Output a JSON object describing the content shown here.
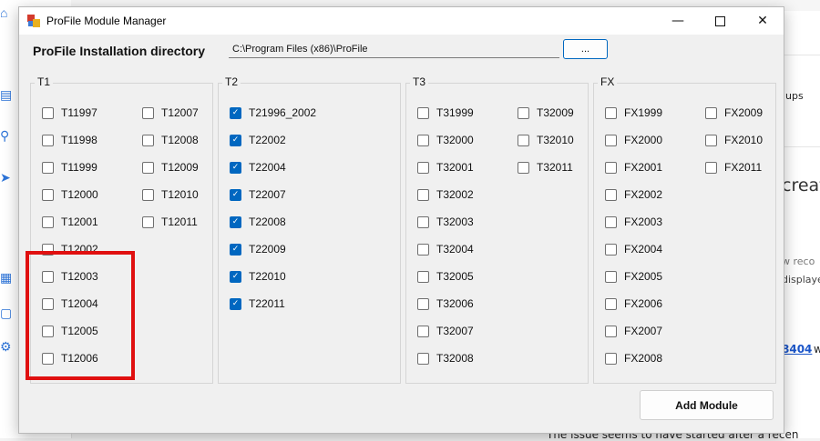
{
  "background": {
    "snippets": [
      "ups",
      "creat",
      "w reco",
      "displaye",
      "8404",
      "w"
    ],
    "bottom_text": "The issue seems to have started after a recen"
  },
  "window": {
    "title": "ProFile Module Manager",
    "minimize_glyph": "—",
    "close_glyph": "✕"
  },
  "install": {
    "label": "ProFile Installation directory",
    "path": "C:\\Program Files (x86)\\ProFile",
    "browse_label": "..."
  },
  "groups": [
    {
      "title": "T1",
      "columns": [
        [
          {
            "label": "T11997",
            "checked": false
          },
          {
            "label": "T11998",
            "checked": false
          },
          {
            "label": "T11999",
            "checked": false
          },
          {
            "label": "T12000",
            "checked": false
          },
          {
            "label": "T12001",
            "checked": false
          },
          {
            "label": "T12002",
            "checked": false
          },
          {
            "label": "T12003",
            "checked": false
          },
          {
            "label": "T12004",
            "checked": false
          },
          {
            "label": "T12005",
            "checked": false
          },
          {
            "label": "T12006",
            "checked": false
          }
        ],
        [
          {
            "label": "T12007",
            "checked": false
          },
          {
            "label": "T12008",
            "checked": false
          },
          {
            "label": "T12009",
            "checked": false
          },
          {
            "label": "T12010",
            "checked": false
          },
          {
            "label": "T12011",
            "checked": false
          }
        ]
      ]
    },
    {
      "title": "T2",
      "columns": [
        [
          {
            "label": "T21996_2002",
            "checked": true
          },
          {
            "label": "T22002",
            "checked": true
          },
          {
            "label": "T22004",
            "checked": true
          },
          {
            "label": "T22007",
            "checked": true
          },
          {
            "label": "T22008",
            "checked": true
          },
          {
            "label": "T22009",
            "checked": true
          },
          {
            "label": "T22010",
            "checked": true
          },
          {
            "label": "T22011",
            "checked": true
          }
        ]
      ]
    },
    {
      "title": "T3",
      "columns": [
        [
          {
            "label": "T31999",
            "checked": false
          },
          {
            "label": "T32000",
            "checked": false
          },
          {
            "label": "T32001",
            "checked": false
          },
          {
            "label": "T32002",
            "checked": false
          },
          {
            "label": "T32003",
            "checked": false
          },
          {
            "label": "T32004",
            "checked": false
          },
          {
            "label": "T32005",
            "checked": false
          },
          {
            "label": "T32006",
            "checked": false
          },
          {
            "label": "T32007",
            "checked": false
          },
          {
            "label": "T32008",
            "checked": false
          }
        ],
        [
          {
            "label": "T32009",
            "checked": false
          },
          {
            "label": "T32010",
            "checked": false
          },
          {
            "label": "T32011",
            "checked": false
          }
        ]
      ]
    },
    {
      "title": "FX",
      "columns": [
        [
          {
            "label": "FX1999",
            "checked": false
          },
          {
            "label": "FX2000",
            "checked": false
          },
          {
            "label": "FX2001",
            "checked": false
          },
          {
            "label": "FX2002",
            "checked": false
          },
          {
            "label": "FX2003",
            "checked": false
          },
          {
            "label": "FX2004",
            "checked": false
          },
          {
            "label": "FX2005",
            "checked": false
          },
          {
            "label": "FX2006",
            "checked": false
          },
          {
            "label": "FX2007",
            "checked": false
          },
          {
            "label": "FX2008",
            "checked": false
          }
        ],
        [
          {
            "label": "FX2009",
            "checked": false
          },
          {
            "label": "FX2010",
            "checked": false
          },
          {
            "label": "FX2011",
            "checked": false
          }
        ]
      ]
    }
  ],
  "actions": {
    "add_module_label": "Add Module"
  },
  "colors": {
    "accent": "#0067c0",
    "highlight": "#e01010"
  }
}
